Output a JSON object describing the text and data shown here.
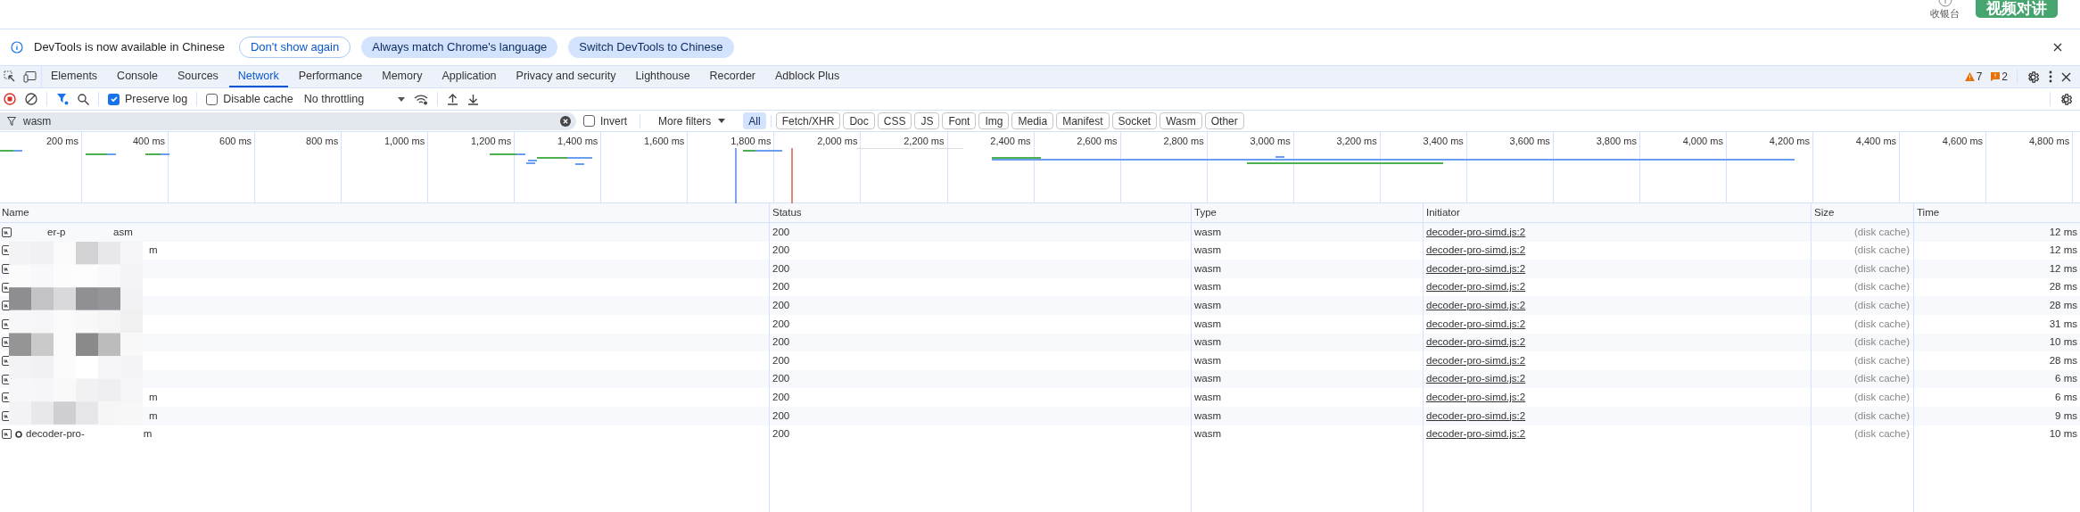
{
  "page_header": {
    "cashier_label": "收银台",
    "video_button": "视频对讲"
  },
  "banner": {
    "message": "DevTools is now available in Chinese",
    "buttons": [
      {
        "label": "Don't show again",
        "kind": "outline"
      },
      {
        "label": "Always match Chrome's language",
        "kind": "filled"
      },
      {
        "label": "Switch DevTools to Chinese",
        "kind": "filled"
      }
    ]
  },
  "tabs": [
    {
      "label": "Elements",
      "selected": false
    },
    {
      "label": "Console",
      "selected": false
    },
    {
      "label": "Sources",
      "selected": false
    },
    {
      "label": "Network",
      "selected": true
    },
    {
      "label": "Performance",
      "selected": false
    },
    {
      "label": "Memory",
      "selected": false
    },
    {
      "label": "Application",
      "selected": false
    },
    {
      "label": "Privacy and security",
      "selected": false
    },
    {
      "label": "Lighthouse",
      "selected": false
    },
    {
      "label": "Recorder",
      "selected": false
    },
    {
      "label": "Adblock Plus",
      "selected": false
    }
  ],
  "counters": {
    "warnings": "7",
    "issues": "2"
  },
  "toolbar": {
    "preserve_log": {
      "label": "Preserve log",
      "checked": true
    },
    "disable_cache": {
      "label": "Disable cache",
      "checked": false
    },
    "throttling": "No throttling"
  },
  "filter": {
    "value": "wasm",
    "invert": {
      "label": "Invert",
      "checked": false
    },
    "more_filters": "More filters",
    "types": [
      {
        "label": "All",
        "selected": true
      },
      {
        "label": "Fetch/XHR",
        "selected": false
      },
      {
        "label": "Doc",
        "selected": false
      },
      {
        "label": "CSS",
        "selected": false
      },
      {
        "label": "JS",
        "selected": false
      },
      {
        "label": "Font",
        "selected": false
      },
      {
        "label": "Img",
        "selected": false
      },
      {
        "label": "Media",
        "selected": false
      },
      {
        "label": "Manifest",
        "selected": false
      },
      {
        "label": "Socket",
        "selected": false
      },
      {
        "label": "Wasm",
        "selected": false
      },
      {
        "label": "Other",
        "selected": false
      }
    ]
  },
  "overview": {
    "ticks": [
      "200 ms",
      "400 ms",
      "600 ms",
      "800 ms",
      "1,000 ms",
      "1,200 ms",
      "1,400 ms",
      "1,600 ms",
      "1,800 ms",
      "2,000 ms",
      "2,200 ms",
      "2,400 ms",
      "2,600 ms",
      "2,800 ms",
      "3,000 ms",
      "3,200 ms",
      "3,400 ms",
      "3,600 ms",
      "3,800 ms",
      "4,000 ms",
      "4,200 ms",
      "4,400 ms",
      "4,600 ms",
      "4,800 ms"
    ]
  },
  "table": {
    "columns": [
      "Name",
      "Status",
      "Type",
      "Initiator",
      "Size",
      "Time"
    ],
    "rows": [
      {
        "name_parts": [
          "er-p",
          "asm"
        ],
        "status": "200",
        "type": "wasm",
        "initiator": "decoder-pro-simd.js:2",
        "size": "(disk cache)",
        "time": "12 ms"
      },
      {
        "name_parts": [
          "m"
        ],
        "status": "200",
        "type": "wasm",
        "initiator": "decoder-pro-simd.js:2",
        "size": "(disk cache)",
        "time": "12 ms"
      },
      {
        "name_parts": [],
        "status": "200",
        "type": "wasm",
        "initiator": "decoder-pro-simd.js:2",
        "size": "(disk cache)",
        "time": "12 ms"
      },
      {
        "name_parts": [],
        "status": "200",
        "type": "wasm",
        "initiator": "decoder-pro-simd.js:2",
        "size": "(disk cache)",
        "time": "28 ms"
      },
      {
        "name_parts": [],
        "status": "200",
        "type": "wasm",
        "initiator": "decoder-pro-simd.js:2",
        "size": "(disk cache)",
        "time": "28 ms"
      },
      {
        "name_parts": [],
        "status": "200",
        "type": "wasm",
        "initiator": "decoder-pro-simd.js:2",
        "size": "(disk cache)",
        "time": "31 ms"
      },
      {
        "name_parts": [],
        "status": "200",
        "type": "wasm",
        "initiator": "decoder-pro-simd.js:2",
        "size": "(disk cache)",
        "time": "10 ms"
      },
      {
        "name_parts": [],
        "status": "200",
        "type": "wasm",
        "initiator": "decoder-pro-simd.js:2",
        "size": "(disk cache)",
        "time": "28 ms"
      },
      {
        "name_parts": [],
        "status": "200",
        "type": "wasm",
        "initiator": "decoder-pro-simd.js:2",
        "size": "(disk cache)",
        "time": "6 ms"
      },
      {
        "name_parts": [
          "m"
        ],
        "status": "200",
        "type": "wasm",
        "initiator": "decoder-pro-simd.js:2",
        "size": "(disk cache)",
        "time": "6 ms"
      },
      {
        "name_parts": [
          "m"
        ],
        "status": "200",
        "type": "wasm",
        "initiator": "decoder-pro-simd.js:2",
        "size": "(disk cache)",
        "time": "9 ms"
      },
      {
        "name_parts": [
          "decoder-pro-",
          "m"
        ],
        "status": "200",
        "type": "wasm",
        "initiator": "decoder-pro-simd.js:2",
        "size": "(disk cache)",
        "time": "10 ms"
      }
    ]
  }
}
